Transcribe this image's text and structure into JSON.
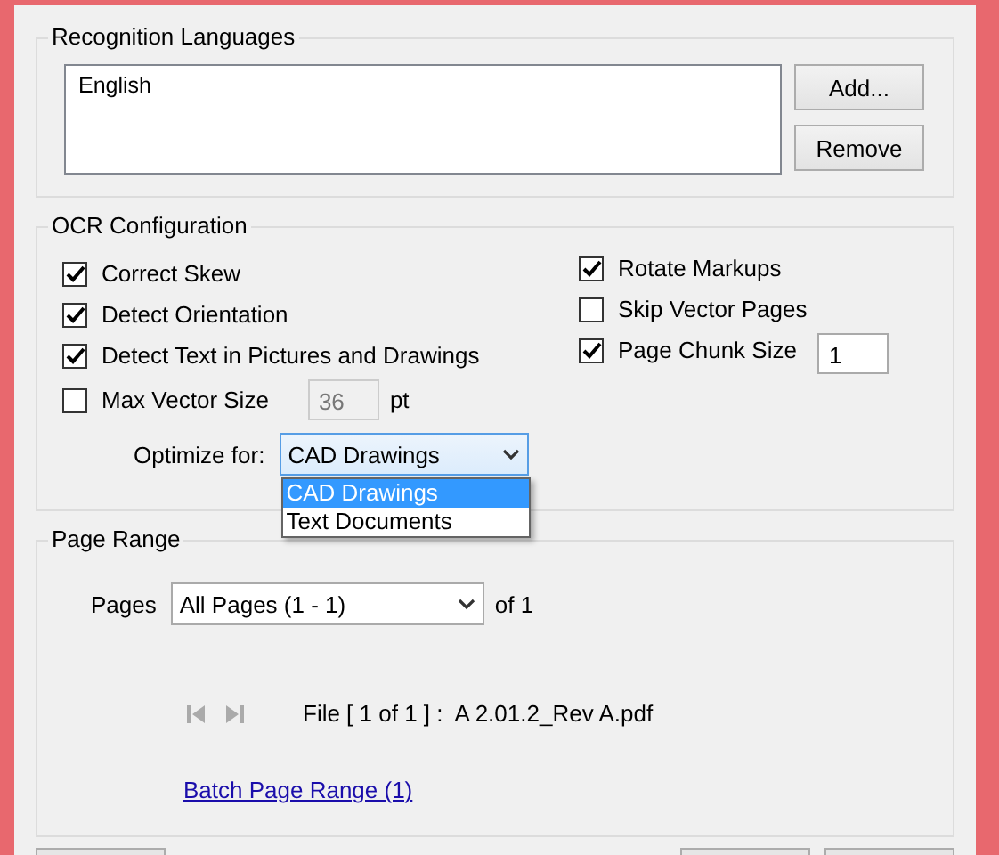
{
  "languages": {
    "title": "Recognition Languages",
    "items": [
      "English"
    ],
    "buttons": [
      "Add...",
      "Remove"
    ]
  },
  "ocr": {
    "title": "OCR Configuration",
    "left": [
      {
        "label": "Correct Skew",
        "checked": true
      },
      {
        "label": "Detect Orientation",
        "checked": true
      },
      {
        "label": "Detect Text in Pictures and Drawings",
        "checked": true
      },
      {
        "label": "Max Vector Size",
        "checked": false,
        "value": "36",
        "unit": "pt"
      }
    ],
    "right": [
      {
        "label": "Rotate Markups",
        "checked": true
      },
      {
        "label": "Skip Vector Pages",
        "checked": false
      },
      {
        "label": "Page Chunk Size",
        "checked": true,
        "value": "1"
      }
    ],
    "optimize": {
      "label": "Optimize for:",
      "value": "CAD Drawings",
      "expanded": true,
      "options": [
        {
          "label": "CAD Drawings",
          "selected": true
        },
        {
          "label": "Text Documents",
          "selected": false
        }
      ]
    }
  },
  "page_range": {
    "title": "Page Range",
    "pages_label": "Pages",
    "pages_value": "All Pages (1 - 1)",
    "of": "of 1",
    "file": "File [ 1 of 1 ] :  A 2.01.2_Rev A.pdf",
    "link": "Batch Page Range (1)"
  }
}
